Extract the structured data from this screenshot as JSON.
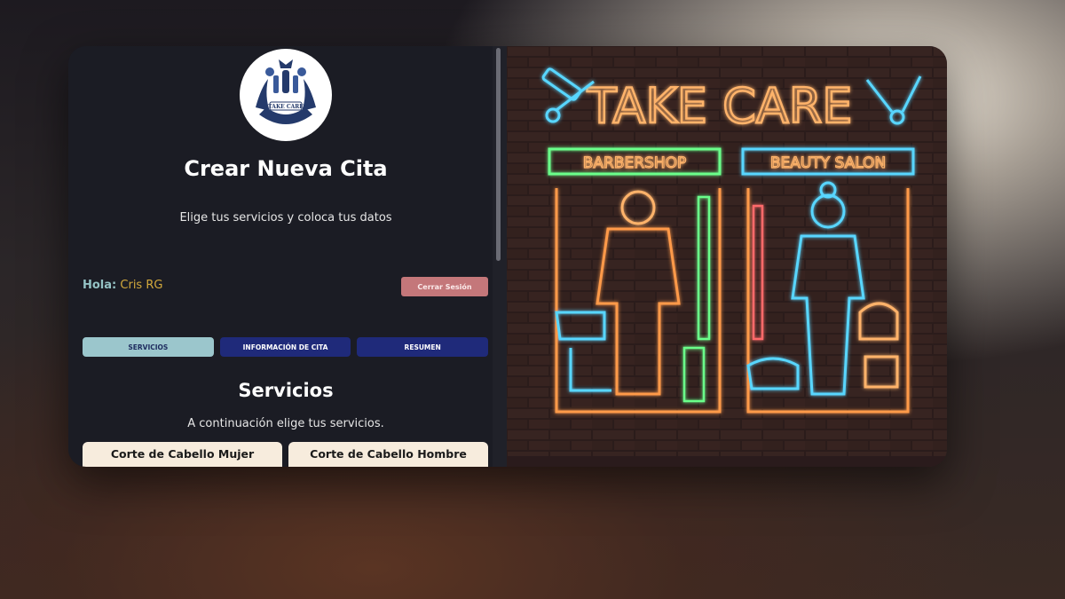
{
  "logo": {
    "text": "TAKE CARE"
  },
  "page": {
    "title": "Crear Nueva Cita",
    "subtitle": "Elige tus servicios y coloca tus datos"
  },
  "user": {
    "greeting_label": "Hola:",
    "name": "Cris RG",
    "logout_label": "Cerrar Sesión"
  },
  "tabs": [
    {
      "label": "SERVICIOS",
      "active": true
    },
    {
      "label": "INFORMACIÓN DE CITA",
      "active": false
    },
    {
      "label": "RESUMEN",
      "active": false
    }
  ],
  "services_section": {
    "title": "Servicios",
    "subtitle": "A continuación elige tus servicios."
  },
  "services": [
    {
      "label": "Corte de Cabello Mujer"
    },
    {
      "label": "Corte de Cabello Hombre"
    }
  ],
  "hero": {
    "headline": "TAKE CARE",
    "left_sign": "BARBERSHOP",
    "right_sign": "BEAUTY SALON"
  },
  "colors": {
    "panel_bg": "#1b1c24",
    "tab_active": "#9bc6cc",
    "tab_inactive": "#1f2a7a",
    "logout": "#c4777a",
    "accent_name": "#d3a93c",
    "neon_orange": "#ff9a4a",
    "neon_blue": "#4ad3ff",
    "neon_green": "#6bff8a"
  }
}
